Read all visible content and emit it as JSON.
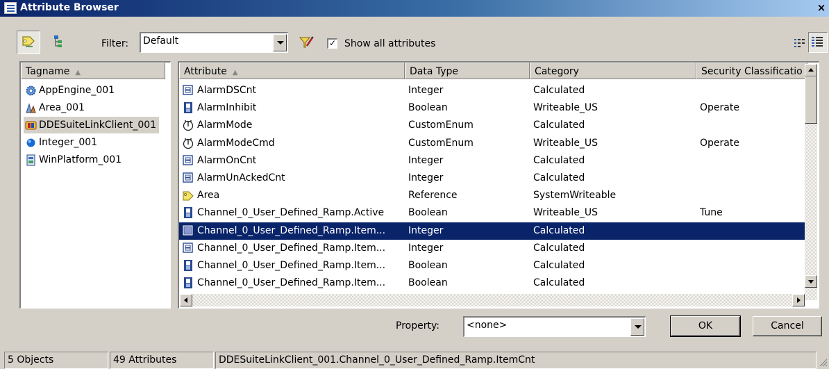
{
  "window": {
    "title": "Attribute Browser",
    "close_glyph": "×"
  },
  "toolbar": {
    "filter_label": "Filter:",
    "filter_value": "Default",
    "show_all_label": "Show all attributes",
    "show_all_checked": "✓"
  },
  "tag_panel": {
    "header": "Tagname",
    "items": [
      {
        "label": "AppEngine_001",
        "icon": "gear-engine-icon"
      },
      {
        "label": "Area_001",
        "icon": "area-icon"
      },
      {
        "label": "DDESuiteLinkClient_001",
        "icon": "di-object-icon"
      },
      {
        "label": "Integer_001",
        "icon": "blue-sphere-icon"
      },
      {
        "label": "WinPlatform_001",
        "icon": "platform-icon"
      }
    ],
    "selected_index": 2
  },
  "attr_table": {
    "columns": [
      "Attribute",
      "Data Type",
      "Category",
      "Security Classificatio"
    ],
    "rows": [
      {
        "attribute": "AlarmDSCnt",
        "type": "Integer",
        "category": "Calculated",
        "security": "",
        "icon": "integer-icon"
      },
      {
        "attribute": "AlarmInhibit",
        "type": "Boolean",
        "category": "Writeable_US",
        "security": "Operate",
        "icon": "boolean-icon"
      },
      {
        "attribute": "AlarmMode",
        "type": "CustomEnum",
        "category": "Calculated",
        "security": "",
        "icon": "enum-icon"
      },
      {
        "attribute": "AlarmModeCmd",
        "type": "CustomEnum",
        "category": "Writeable_US",
        "security": "Operate",
        "icon": "enum-icon"
      },
      {
        "attribute": "AlarmOnCnt",
        "type": "Integer",
        "category": "Calculated",
        "security": "",
        "icon": "integer-icon"
      },
      {
        "attribute": "AlarmUnAckedCnt",
        "type": "Integer",
        "category": "Calculated",
        "security": "",
        "icon": "integer-icon"
      },
      {
        "attribute": "Area",
        "type": "Reference",
        "category": "SystemWriteable",
        "security": "",
        "icon": "reference-icon"
      },
      {
        "attribute": "Channel_0_User_Defined_Ramp.Active",
        "type": "Boolean",
        "category": "Writeable_US",
        "security": "Tune",
        "icon": "boolean-icon"
      },
      {
        "attribute": "Channel_0_User_Defined_Ramp.Item...",
        "type": "Integer",
        "category": "Calculated",
        "security": "",
        "icon": "integer-icon"
      },
      {
        "attribute": "Channel_0_User_Defined_Ramp.Item...",
        "type": "Integer",
        "category": "Calculated",
        "security": "",
        "icon": "integer-icon"
      },
      {
        "attribute": "Channel_0_User_Defined_Ramp.Item...",
        "type": "Boolean",
        "category": "Calculated",
        "security": "",
        "icon": "boolean-icon"
      },
      {
        "attribute": "Channel_0_User_Defined_Ramp.Item...",
        "type": "Boolean",
        "category": "Calculated",
        "security": "",
        "icon": "boolean-icon"
      }
    ],
    "selected_index": 8
  },
  "property": {
    "label": "Property:",
    "value": "<none>"
  },
  "buttons": {
    "ok": "OK",
    "cancel": "Cancel"
  },
  "status": {
    "objects": "5 Objects",
    "attributes": "49 Attributes",
    "path": "DDESuiteLinkClient_001.Channel_0_User_Defined_Ramp.ItemCnt"
  },
  "colors": {
    "selection": "#0a246a",
    "face": "#d4d0c8",
    "title_start": "#0a246a",
    "title_end": "#a6caf0"
  }
}
